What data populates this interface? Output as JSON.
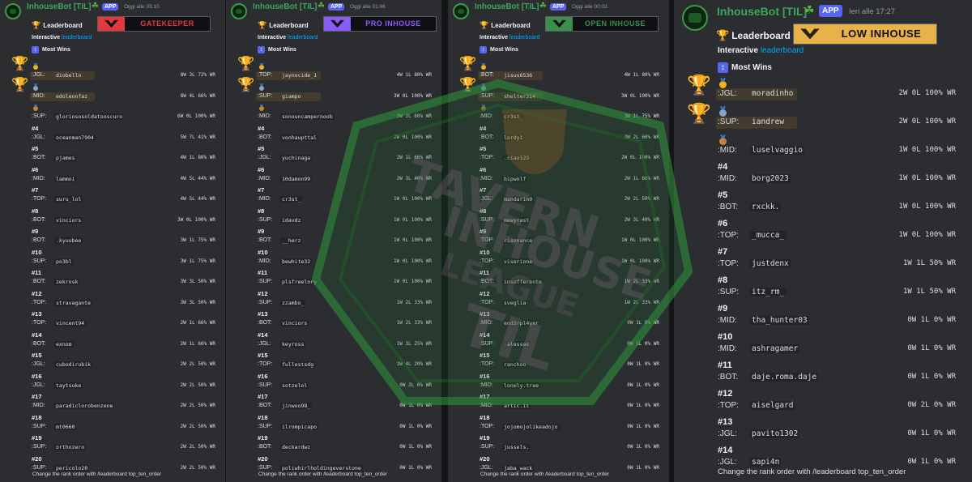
{
  "colors": {
    "background": "#151518",
    "panel": "#2b2d31",
    "bot_name": "#3ba55d",
    "app_badge": "#5865f2",
    "link": "#00a8fc",
    "gold": "#f2b31b"
  },
  "icons": {
    "trophy": "trophy-icon",
    "medal": "medal-icon",
    "bot_avatar": "tavern-inhouse-avatar",
    "sort": "up-down-arrow-icon",
    "plant": "plant-icon"
  },
  "panels": [
    {
      "bot_name": "InhouseBot [TIL]",
      "app_badge": "APP",
      "timestamp": "Oggi alle 05:10",
      "title": "Leaderboard",
      "banner_text": "GATEKEEPER",
      "banner_color": "#e03a3e",
      "interactive_label": "Interactive",
      "interactive_link": "leaderboard",
      "section_title": "Most Wins",
      "footer": "Change the rank order with /leaderboard top_ten_order",
      "entries": [
        {
          "rank": "",
          "role": ":JGL:",
          "name": "diobello",
          "stats": "8W 3L 72% WR"
        },
        {
          "rank": "",
          "role": ":MID:",
          "name": "edoleonfaz",
          "stats": "8W 4L 66% WR"
        },
        {
          "rank": "",
          "role": ":SUP:",
          "name": "gloriososoldatooscuro",
          "stats": "6W 0L 100% WR"
        },
        {
          "rank": "#4",
          "role": ":JGL:",
          "name": "oceanman7904",
          "stats": "5W 7L 41% WR"
        },
        {
          "rank": "#5",
          "role": ":BOT:",
          "name": "pjames",
          "stats": "4W 1L 80% WR"
        },
        {
          "rank": "#6",
          "role": ":MID:",
          "name": "lammoi",
          "stats": "4W 5L 44% WR"
        },
        {
          "rank": "#7",
          "role": ":TOP:",
          "name": "suru_lol",
          "stats": "4W 5L 44% WR"
        },
        {
          "rank": "#8",
          "role": ":BOT:",
          "name": "vinciors",
          "stats": "3W 0L 100% WR"
        },
        {
          "rank": "#9",
          "role": ":BOT:",
          "name": ".kyuubee",
          "stats": "3W 1L 75% WR"
        },
        {
          "rank": "#10",
          "role": ":SUP:",
          "name": "po3bl",
          "stats": "3W 1L 75% WR"
        },
        {
          "rank": "#11",
          "role": ":BOT:",
          "name": "zekrosk",
          "stats": "3W 3L 50% WR"
        },
        {
          "rank": "#12",
          "role": ":TOP:",
          "name": "stravagante",
          "stats": "3W 3L 50% WR"
        },
        {
          "rank": "#13",
          "role": ":TOP:",
          "name": "vincent94",
          "stats": "2W 1L 66% WR"
        },
        {
          "rank": "#14",
          "role": ":BOT:",
          "name": "exnom",
          "stats": "2W 1L 66% WR"
        },
        {
          "rank": "#15",
          "role": ":JGL:",
          "name": "cubodirubik",
          "stats": "2W 2L 50% WR"
        },
        {
          "rank": "#16",
          "role": ":JGL:",
          "name": "taytsuke",
          "stats": "2W 2L 50% WR"
        },
        {
          "rank": "#17",
          "role": ":MID:",
          "name": "paradiclorobenzene",
          "stats": "2W 2L 50% WR"
        },
        {
          "rank": "#18",
          "role": ":SUP:",
          "name": "mt0660",
          "stats": "2W 2L 50% WR"
        },
        {
          "rank": "#19",
          "role": ":SUP:",
          "name": "orthozero",
          "stats": "2W 2L 50% WR"
        },
        {
          "rank": "#20",
          "role": ":SUP:",
          "name": "pericolo20",
          "stats": "2W 2L 50% WR"
        }
      ]
    },
    {
      "bot_name": "InhouseBot [TIL]",
      "app_badge": "APP",
      "timestamp": "Oggi alle 01:46",
      "title": "Leaderboard",
      "banner_text": "PRO INHOUSE",
      "banner_color": "#8a5cf6",
      "interactive_label": "Interactive",
      "interactive_link": "leaderboard",
      "section_title": "Most Wins",
      "footer": "Change the rank order with /leaderboard top_ten_order",
      "entries": [
        {
          "rank": "",
          "role": ":TOP:",
          "name": "jaynocide_1",
          "stats": "4W 1L 80% WR"
        },
        {
          "rank": "",
          "role": ":SUP:",
          "name": "giampo",
          "stats": "3W 0L 100% WR"
        },
        {
          "rank": "",
          "role": ":MID:",
          "name": "sonouncampernoob",
          "stats": "3W 2L 60% WR"
        },
        {
          "rank": "#4",
          "role": ":BOT:",
          "name": "vonhaupttal",
          "stats": "2W 0L 100% WR"
        },
        {
          "rank": "#5",
          "role": ":JGL:",
          "name": "yuchinaga",
          "stats": "2W 1L 66% WR"
        },
        {
          "rank": "#6",
          "role": ":MID:",
          "name": "10damon99",
          "stats": "2W 3L 40% WR"
        },
        {
          "rank": "#7",
          "role": ":MID:",
          "name": "cr3st_",
          "stats": "1W 0L 100% WR"
        },
        {
          "rank": "#8",
          "role": ":SUP:",
          "name": "idavdz",
          "stats": "1W 0L 100% WR"
        },
        {
          "rank": "#9",
          "role": ":BOT:",
          "name": "__herz",
          "stats": "1W 0L 100% WR"
        },
        {
          "rank": "#10",
          "role": ":MID:",
          "name": "bewhite32",
          "stats": "1W 0L 100% WR"
        },
        {
          "rank": "#11",
          "role": ":SUP:",
          "name": "plsfreelory",
          "stats": "1W 0L 100% WR"
        },
        {
          "rank": "#12",
          "role": ":SUP:",
          "name": "zzambo_",
          "stats": "1W 2L 33% WR"
        },
        {
          "rank": "#13",
          "role": ":BOT:",
          "name": "vinciors",
          "stats": "1W 2L 33% WR"
        },
        {
          "rank": "#14",
          "role": ":JGL:",
          "name": "keyross",
          "stats": "1W 3L 25% WR"
        },
        {
          "rank": "#15",
          "role": ":TOP:",
          "name": "fullestsdg",
          "stats": "1W 4L 20% WR"
        },
        {
          "rank": "#16",
          "role": ":SUP:",
          "name": "sotzelol",
          "stats": "0W 2L 0% WR"
        },
        {
          "rank": "#17",
          "role": ":BOT:",
          "name": "jinwoo98_",
          "stats": "0W 1L 0% WR"
        },
        {
          "rank": "#18",
          "role": ":SUP:",
          "name": "ilrompicapo",
          "stats": "0W 1L 0% WR"
        },
        {
          "rank": "#19",
          "role": ":BOT:",
          "name": "deckardwz",
          "stats": "0W 1L 0% WR"
        },
        {
          "rank": "#20",
          "role": ":SUP:",
          "name": "poliwhirlholdingeverstone",
          "stats": "0W 1L 0% WR"
        }
      ]
    },
    {
      "bot_name": "InhouseBot [TIL]",
      "app_badge": "APP",
      "timestamp": "Oggi alle 00:03",
      "title": "Leaderboard",
      "banner_text": "OPEN INHOUSE",
      "banner_color": "#3a8f4a",
      "interactive_label": "Interactive",
      "interactive_link": "leaderboard",
      "section_title": "Most Wins",
      "footer": "Change the rank order with /leaderboard top_ten_order",
      "entries": [
        {
          "rank": "",
          "role": ":BOT:",
          "name": "jisus6536",
          "stats": "4W 1L 80% WR"
        },
        {
          "rank": "",
          "role": ":SUP:",
          "name": "shelter314",
          "stats": "3W 0L 100% WR"
        },
        {
          "rank": "",
          "role": ":MID:",
          "name": "cr3st_",
          "stats": "3W 1L 75% WR"
        },
        {
          "rank": "#4",
          "role": ":BOT:",
          "name": "lordy1",
          "stats": "3W 2L 60% WR"
        },
        {
          "rank": "#5",
          "role": ":TOP:",
          "name": ".ciao123",
          "stats": "2W 0L 100% WR"
        },
        {
          "rank": "#6",
          "role": ":MID:",
          "name": "bipwolf",
          "stats": "2W 1L 66% WR"
        },
        {
          "rank": "#7",
          "role": ":JGL:",
          "name": "mandarin0",
          "stats": "2W 2L 50% WR"
        },
        {
          "rank": "#8",
          "role": ":SUP:",
          "name": "mewyrast",
          "stats": "2W 3L 40% WR"
        },
        {
          "rank": "#9",
          "role": ":TOP:",
          "name": "risonance",
          "stats": "1W 0L 100% WR"
        },
        {
          "rank": "#10",
          "role": ":TOP:",
          "name": "viserione",
          "stats": "1W 0L 100% WR"
        },
        {
          "rank": "#11",
          "role": ":BOT:",
          "name": "insofferente",
          "stats": "1W 2L 33% WR"
        },
        {
          "rank": "#12",
          "role": ":TOP:",
          "name": "sveglia",
          "stats": "1W 2L 33% WR"
        },
        {
          "rank": "#13",
          "role": ":MID:",
          "name": "end3rpl4yer",
          "stats": "0W 1L 0% WR"
        },
        {
          "rank": "#14",
          "role": ":SUP:",
          "name": ".alessas",
          "stats": "0W 1L 0% WR"
        },
        {
          "rank": "#15",
          "role": ":TOP:",
          "name": "ranchoo",
          "stats": "0W 1L 0% WR"
        },
        {
          "rank": "#16",
          "role": ":MID:",
          "name": "lonely.tree",
          "stats": "0W 1L 0% WR"
        },
        {
          "rank": "#17",
          "role": ":MID:",
          "name": "artic.it",
          "stats": "0W 1L 0% WR"
        },
        {
          "rank": "#18",
          "role": ":TOP:",
          "name": "jojomojolikeadojo",
          "stats": "0W 1L 0% WR"
        },
        {
          "rank": "#19",
          "role": ":SUP:",
          "name": "jussels.",
          "stats": "0W 1L 0% WR"
        },
        {
          "rank": "#20",
          "role": ":JGL:",
          "name": "jaba_wack",
          "stats": "0W 1L 0% WR"
        }
      ]
    },
    {
      "bot_name": "InhouseBot [TIL]",
      "app_badge": "APP",
      "timestamp": "Ieri alle 17:27",
      "title": "Leaderboard",
      "banner_text": "LOW INHOUSE",
      "banner_color": "#e8b24a",
      "interactive_label": "Interactive",
      "interactive_link": "leaderboard",
      "section_title": "Most Wins",
      "footer": "Change the rank order with /leaderboard top_ten_order",
      "entries": [
        {
          "rank": "",
          "role": ":JGL:",
          "name": "moradinho",
          "stats": "2W 0L 100% WR"
        },
        {
          "rank": "",
          "role": ":SUP:",
          "name": "iandrew",
          "stats": "2W 0L 100% WR"
        },
        {
          "rank": "",
          "role": ":MID:",
          "name": "luselvaggio",
          "stats": "1W 0L 100% WR"
        },
        {
          "rank": "#4",
          "role": ":MID:",
          "name": "borg2023",
          "stats": "1W 0L 100% WR"
        },
        {
          "rank": "#5",
          "role": ":BOT:",
          "name": "rxckk.",
          "stats": "1W 0L 100% WR"
        },
        {
          "rank": "#6",
          "role": ":TOP:",
          "name": "_mucca_",
          "stats": "1W 0L 100% WR"
        },
        {
          "rank": "#7",
          "role": ":TOP:",
          "name": "justdenx",
          "stats": "1W 1L 50% WR"
        },
        {
          "rank": "#8",
          "role": ":SUP:",
          "name": "itz_rm_",
          "stats": "1W 1L 50% WR"
        },
        {
          "rank": "#9",
          "role": ":MID:",
          "name": "tha_hunter03",
          "stats": "0W 1L 0% WR"
        },
        {
          "rank": "#10",
          "role": ":MID:",
          "name": "ashragamer",
          "stats": "0W 1L 0% WR"
        },
        {
          "rank": "#11",
          "role": ":BOT:",
          "name": "daje.roma.daje",
          "stats": "0W 1L 0% WR"
        },
        {
          "rank": "#12",
          "role": ":TOP:",
          "name": "aiselgard",
          "stats": "0W 2L 0% WR"
        },
        {
          "rank": "#13",
          "role": ":JGL:",
          "name": "pavito1302",
          "stats": "0W 1L 0% WR"
        },
        {
          "rank": "#14",
          "role": ":JGL:",
          "name": "sapi4n",
          "stats": "0W 1L 0% WR"
        }
      ]
    }
  ],
  "watermark_text": [
    "TAVERN",
    "INHOUSE",
    "LEAGUE",
    "TIL"
  ]
}
